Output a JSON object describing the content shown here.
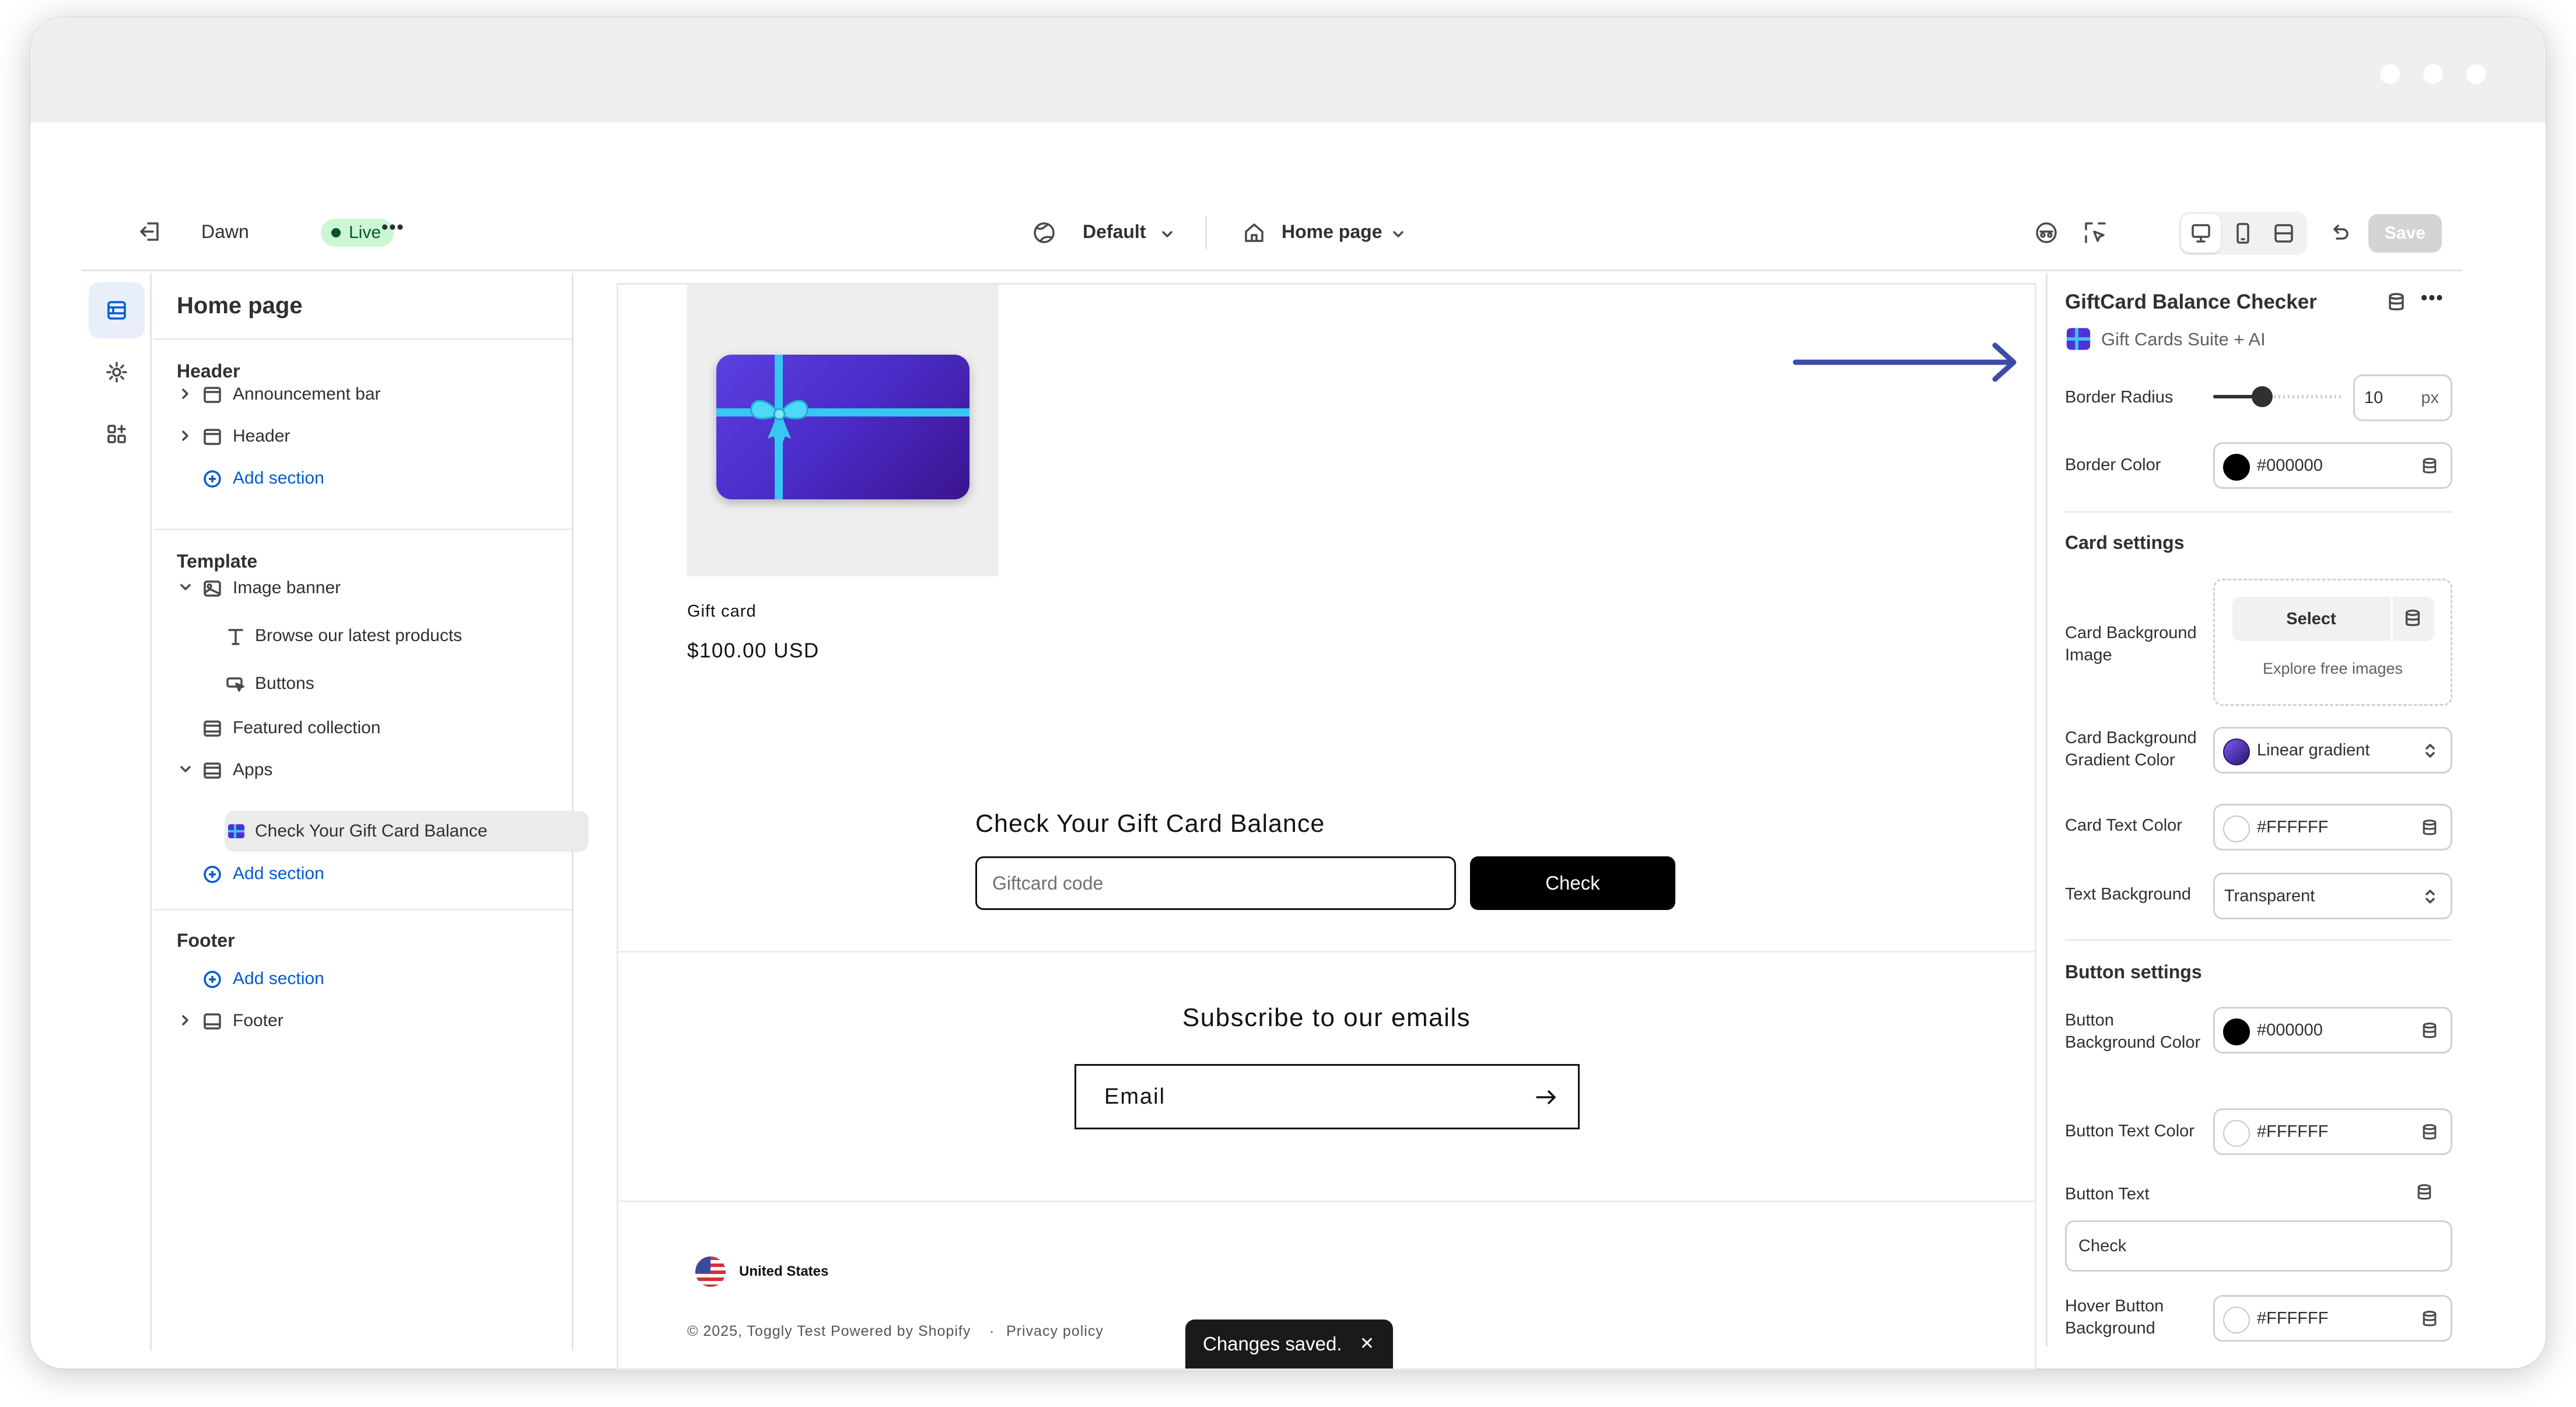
{
  "topbar": {
    "theme_name": "Dawn",
    "live_label": "Live",
    "more_label": "•••",
    "view_selector": "Default",
    "page_selector": "Home page",
    "save_label": "Save"
  },
  "left_panel": {
    "title": "Home page",
    "groups": {
      "header": "Header",
      "template": "Template",
      "footer": "Footer"
    },
    "items": {
      "announcement_bar": "Announcement bar",
      "header": "Header",
      "add_section_1": "Add section",
      "image_banner": "Image banner",
      "browse_products": "Browse our latest products",
      "buttons": "Buttons",
      "featured_collection": "Featured collection",
      "apps": "Apps",
      "check_balance": "Check Your Gift Card Balance",
      "add_section_2": "Add section",
      "add_section_3": "Add section",
      "footer": "Footer"
    }
  },
  "preview": {
    "product_title": "Gift card",
    "product_price": "$100.00 USD",
    "balance_heading": "Check Your Gift Card Balance",
    "giftcard_placeholder": "Giftcard code",
    "check_button": "Check",
    "subscribe_heading": "Subscribe to our emails",
    "email_placeholder": "Email",
    "country": "United States",
    "copyright": "© 2025, Toggly Test Powered by Shopify",
    "separator": "·",
    "privacy": "Privacy policy"
  },
  "toast": {
    "message": "Changes saved.",
    "close": "✕"
  },
  "right_panel": {
    "title": "GiftCard Balance Checker",
    "app_name": "Gift Cards Suite + AI",
    "border_radius_label": "Border Radius",
    "border_radius_value": "10",
    "border_radius_unit": "px",
    "border_radius_slider_fraction": 0.38,
    "border_color_label": "Border Color",
    "border_color_value": "#000000",
    "card_settings_title": "Card settings",
    "card_bg_image_label": "Card Background Image",
    "select_label": "Select",
    "explore_label": "Explore free images",
    "card_gradient_label": "Card Background Gradient Color",
    "card_gradient_value": "Linear gradient",
    "card_text_color_label": "Card Text Color",
    "card_text_color_value": "#FFFFFF",
    "text_background_label": "Text Background",
    "text_background_value": "Transparent",
    "button_settings_title": "Button settings",
    "button_bg_label": "Button Background Color",
    "button_bg_value": "#000000",
    "button_text_color_label": "Button Text Color",
    "button_text_color_value": "#FFFFFF",
    "button_text_label": "Button Text",
    "button_text_value": "Check",
    "hover_bg_label": "Hover Button Background",
    "hover_bg_value": "#FFFFFF"
  },
  "colors": {
    "accent_blue": "#005bd3",
    "live_green": "#caf8d4",
    "arrow": "#3d4aa8"
  }
}
